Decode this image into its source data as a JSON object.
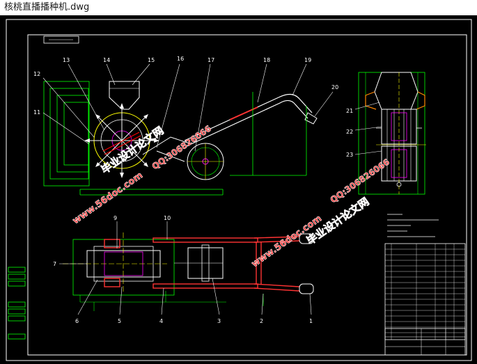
{
  "window": {
    "title": "核桃直播播种机.dwg"
  },
  "drawing": {
    "part_numbers_top": [
      "13",
      "14",
      "15",
      "16",
      "17",
      "18",
      "19",
      "20",
      "12",
      "11"
    ],
    "part_numbers_side": [
      "21",
      "22",
      "23"
    ],
    "part_numbers_bottom": [
      "9",
      "10",
      "7",
      "6",
      "5",
      "4",
      "3",
      "2",
      "1"
    ],
    "watermarks": [
      "毕业设计论文网",
      "www.56doc.com",
      "QQ:306826066"
    ],
    "colors": {
      "background": "#000000",
      "frame": "#ffffff",
      "green": "#00ff00",
      "yellow": "#ffff00",
      "cyan": "#00ffff",
      "magenta": "#ff00ff",
      "red": "#ff0000",
      "watermark": "#ff3333",
      "label": "#ffffff"
    }
  }
}
